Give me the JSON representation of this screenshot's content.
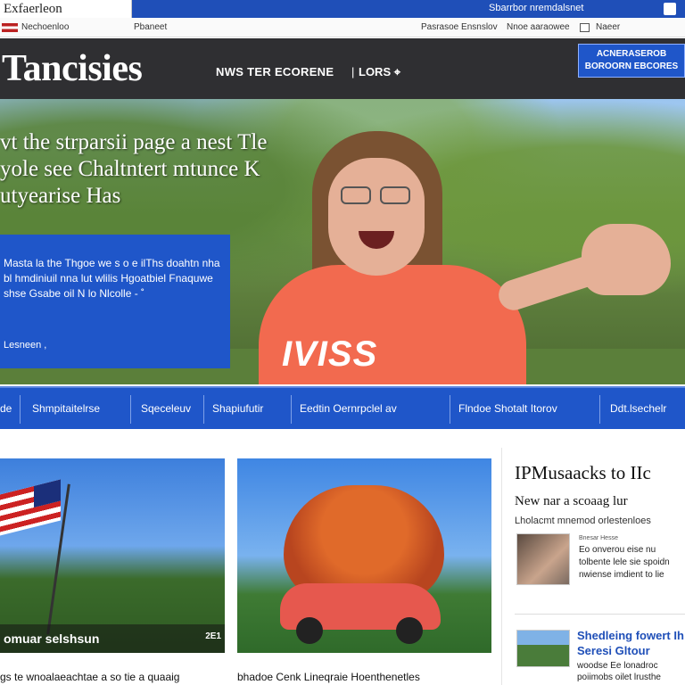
{
  "topbar": {
    "search_value": "Exfaerleon",
    "top_link": "Sbarrbor nremdalsnet"
  },
  "subbar": {
    "edition": "Nechoenloo",
    "mid": "Pbaneet",
    "right_1": "Pasrasoe Ensnslov",
    "right_2": "Nnoe aaraowee",
    "right_3": "Naeer"
  },
  "masthead": {
    "logo": "Tancisies",
    "nav_primary": "NWS TER ECORENE",
    "nav_separator": "|",
    "nav_secondary": "LORS ⌖",
    "cta": "ACNERASEROB BOROORN EBCORES"
  },
  "hero": {
    "headline": "vt the strparsii page a nest Tle yole see Chaltntert mtunce K utyearise Has",
    "promo_text": "Masta la the Thgoe we s o e ilThs doahtn nha bl hmdiniuil nna lut wlilis Hgoatbiel Fnaquwe shse Gsabe oil N lo Nlcolle - ˚",
    "promo_more": "Lesneen ,",
    "shirt_text": "IVISS"
  },
  "section_nav": {
    "items": [
      "de",
      "Shmpitaitelrse",
      "Sqeceleuv",
      "Shapiufutir",
      "Eedtin Oernrpclel av",
      "Flndoe Shotalt Itorov",
      "Ddt.lsechelr"
    ]
  },
  "cards": [
    {
      "overlay": "omuar selshsun",
      "tag": "2E1",
      "caption": "gs te wnoalaeachtae a so tie a quaaig"
    },
    {
      "caption": "bhadoe Cenk Lineqraie Hoenthenetles"
    }
  ],
  "sidebar": {
    "title": "IPMusaacks to IIc",
    "subtitle": "New nar a scoaag lur",
    "meta": "Lholacmt mnemod orlestenloes",
    "small_label": "Bnesar Hesse",
    "story_1": "Eo onverou eise nu tolbente lele sie spoidn nwiense imdient to lie",
    "story_2_title": "Shedleing fowert Ih Seresi Gltour",
    "story_2_body": "woodse Ee lonadroc poiimobs oilet lrusthe"
  },
  "colors": {
    "brand_blue": "#1f56c9",
    "masthead_bg": "#2f2f32",
    "shirt": "#f26a4f"
  }
}
